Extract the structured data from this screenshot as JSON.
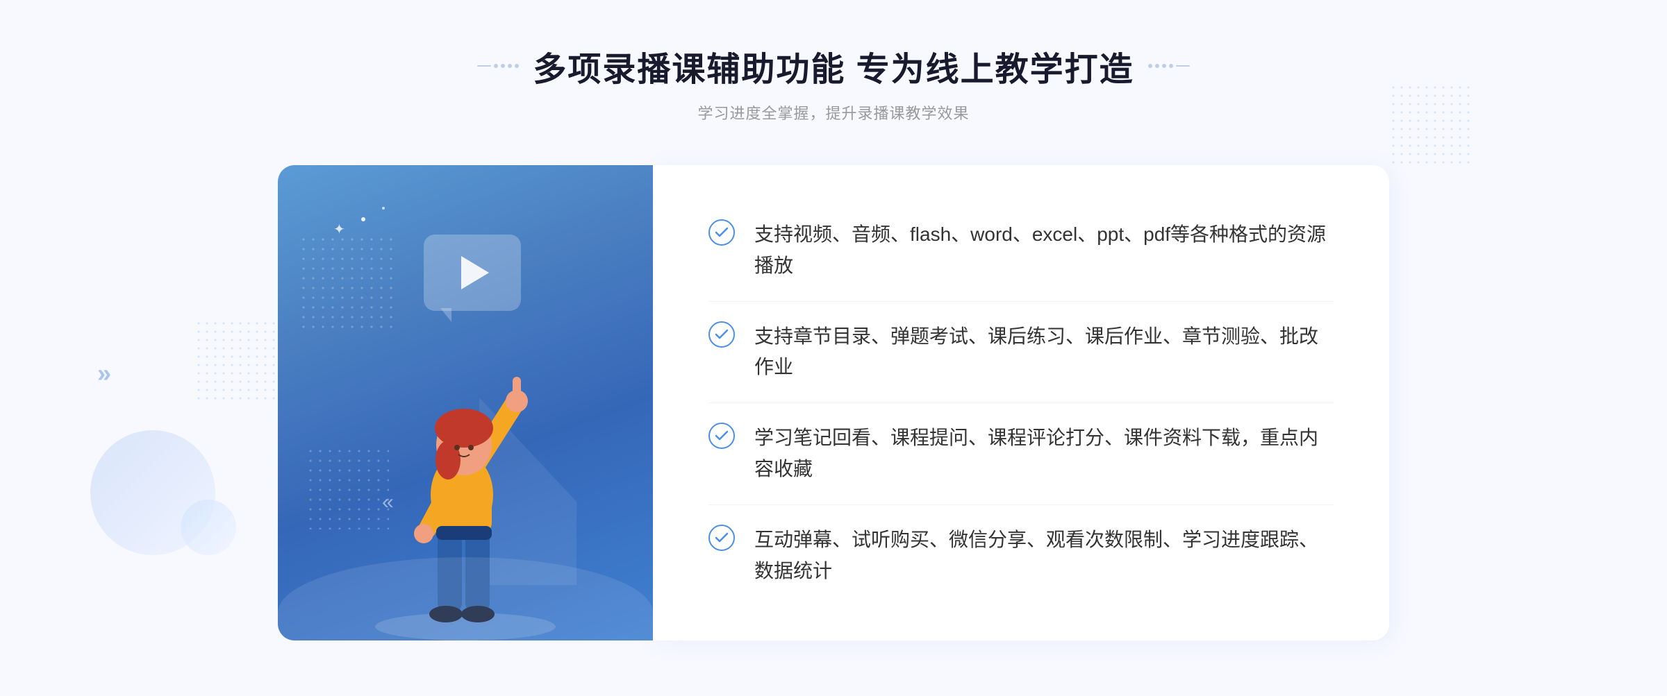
{
  "page": {
    "background": "#f8f9ff"
  },
  "header": {
    "title": "多项录播课辅助功能 专为线上教学打造",
    "subtitle": "学习进度全掌握，提升录播课教学效果",
    "title_deco_left": "decoration-left",
    "title_deco_right": "decoration-right"
  },
  "features": [
    {
      "id": 1,
      "text": "支持视频、音频、flash、word、excel、ppt、pdf等各种格式的资源播放"
    },
    {
      "id": 2,
      "text": "支持章节目录、弹题考试、课后练习、课后作业、章节测验、批改作业"
    },
    {
      "id": 3,
      "text": "学习笔记回看、课程提问、课程评论打分、课件资料下载，重点内容收藏"
    },
    {
      "id": 4,
      "text": "互动弹幕、试听购买、微信分享、观看次数限制、学习进度跟踪、数据统计"
    }
  ],
  "colors": {
    "primary_blue": "#4a8fe8",
    "gradient_start": "#5b9bd5",
    "gradient_end": "#3567b8",
    "text_dark": "#1a1a2e",
    "text_gray": "#999999",
    "text_feature": "#333333",
    "white": "#ffffff"
  }
}
